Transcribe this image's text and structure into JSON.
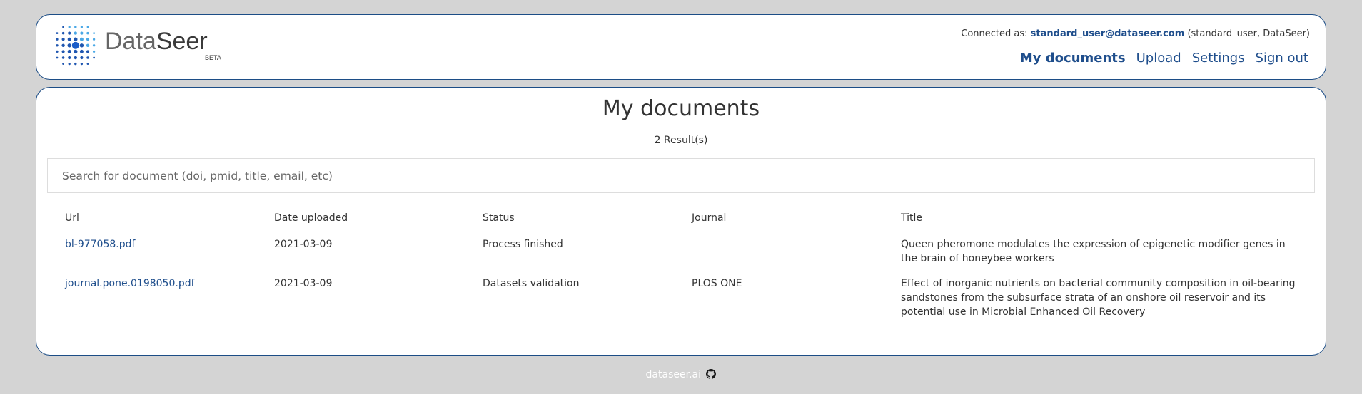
{
  "header": {
    "logo": {
      "brand_light": "Data",
      "brand_dark": "Seer",
      "badge": "BETA"
    },
    "connected": {
      "prefix": "Connected as:",
      "email": "standard_user@dataseer.com",
      "suffix": "(standard_user, DataSeer)"
    },
    "nav": [
      {
        "label": "My documents",
        "active": true
      },
      {
        "label": "Upload",
        "active": false
      },
      {
        "label": "Settings",
        "active": false
      },
      {
        "label": "Sign out",
        "active": false
      }
    ]
  },
  "main": {
    "title": "My documents",
    "results": "2 Result(s)",
    "search": {
      "placeholder": "Search for document (doi, pmid, title, email, etc)",
      "value": ""
    },
    "columns": [
      "Url",
      "Date uploaded",
      "Status",
      "Journal",
      "Title"
    ],
    "rows": [
      {
        "url": "bl-977058.pdf",
        "date": "2021-03-09",
        "status": "Process finished",
        "journal": "",
        "title": "Queen pheromone modulates the expression of epigenetic modifier genes in the brain of honeybee workers"
      },
      {
        "url": "journal.pone.0198050.pdf",
        "date": "2021-03-09",
        "status": "Datasets validation",
        "journal": "PLOS ONE",
        "title": "Effect of inorganic nutrients on bacterial community composition in oil-bearing sandstones from the subsurface strata of an onshore oil reservoir and its potential use in Microbial Enhanced Oil Recovery"
      }
    ]
  },
  "footer": {
    "link": "dataseer.ai",
    "icon": "github-icon"
  },
  "colors": {
    "accent": "#1f4e8c",
    "border": "#1c4d86",
    "background": "#d4d4d4"
  }
}
